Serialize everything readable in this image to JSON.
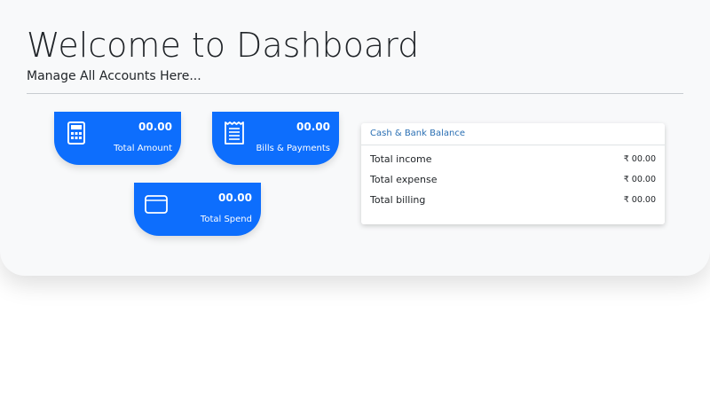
{
  "header": {
    "title": "Welcome to Dashboard",
    "subtitle": "Manage All Accounts Here..."
  },
  "cards": [
    {
      "icon": "calculator-icon",
      "amount": "00.00",
      "label": "Total Amount"
    },
    {
      "icon": "receipt-icon",
      "amount": "00.00",
      "label": "Bills & Payments"
    },
    {
      "icon": "wallet-icon",
      "amount": "00.00",
      "label": "Total Spend"
    }
  ],
  "balance": {
    "title": "Cash & Bank Balance",
    "rows": [
      {
        "label": "Total income",
        "value": "₹ 00.00"
      },
      {
        "label": "Total expense",
        "value": "₹ 00.00"
      },
      {
        "label": "Total billing",
        "value": "₹ 00.00"
      }
    ]
  },
  "colors": {
    "accent": "#0d6efd",
    "panel_background": "#f8f9fa",
    "balance_title": "#2a6fb3"
  }
}
